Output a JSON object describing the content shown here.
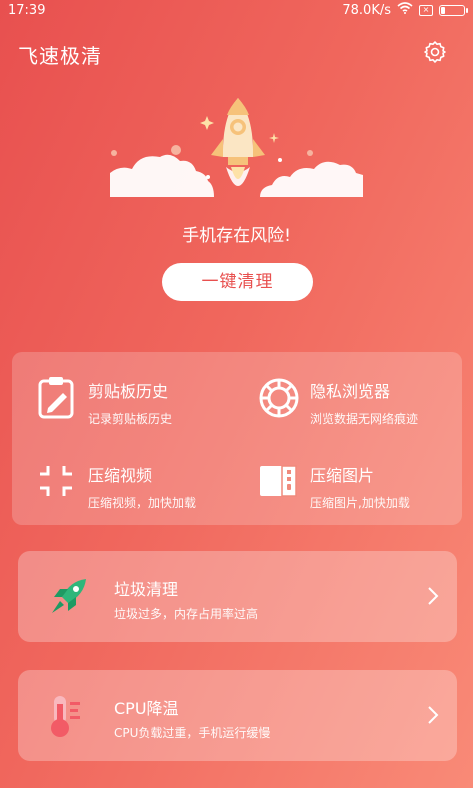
{
  "status": {
    "time": "17:39",
    "speed": "78.0K/s"
  },
  "header": {
    "title": "飞速极清"
  },
  "hero": {
    "risk_text": "手机存在风险!",
    "clean_button": "一键清理"
  },
  "tools": [
    {
      "title": "剪贴板历史",
      "subtitle": "记录剪贴板历史",
      "icon": "clipboard-icon"
    },
    {
      "title": "隐私浏览器",
      "subtitle": "浏览数据无网络痕迹",
      "icon": "browser-icon"
    },
    {
      "title": "压缩视频",
      "subtitle": "压缩视频，加快加载",
      "icon": "compress-video-icon"
    },
    {
      "title": "压缩图片",
      "subtitle": "压缩图片,加快加载",
      "icon": "compress-image-icon"
    }
  ],
  "features": [
    {
      "title": "垃圾清理",
      "subtitle": "垃圾过多，内存占用率过高",
      "icon": "rocket-icon"
    },
    {
      "title": "CPU降温",
      "subtitle": "CPU负载过重，手机运行缓慢",
      "icon": "thermometer-icon"
    }
  ],
  "colors": {
    "background_start": "#e8504f",
    "background_end": "#f98a77",
    "rocket_green": "#2fb67a",
    "thermo_red": "#f25b66"
  }
}
